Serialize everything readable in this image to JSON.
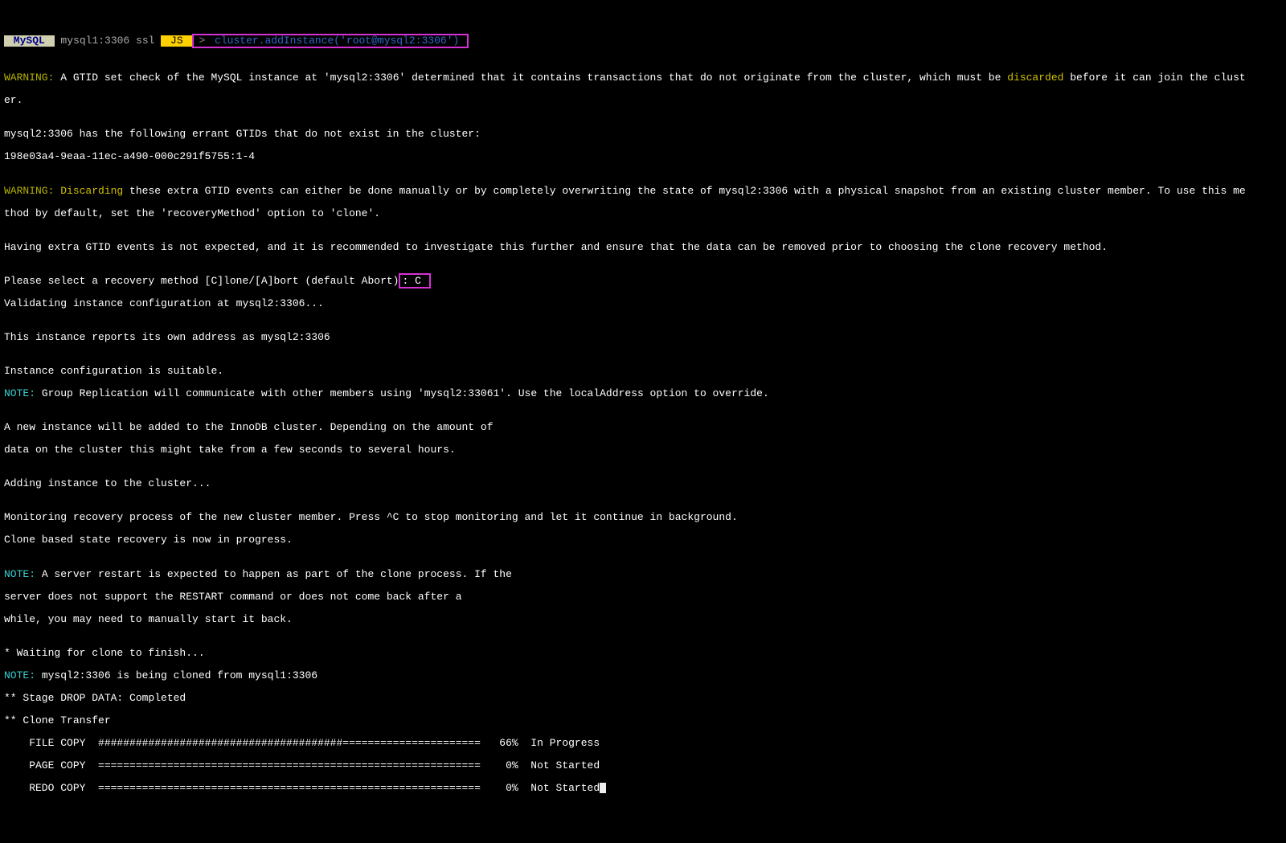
{
  "prompt": {
    "mysql_badge": " MySQL ",
    "connection": " mysql1:3306 ssl ",
    "lang_badge": " JS ",
    "arrow": ">",
    "command": " cluster.addInstance('root@mysql2:3306') "
  },
  "lines": {
    "w1_label": "WARNING:",
    "w1_a": " A GTID set check of the MySQL instance at 'mysql2:3306' determined that it contains transactions that do not originate from the cluster, which must be ",
    "w1_disc": "discarded",
    "w1_b": " before it can join the clust",
    "w1_c": "er.",
    "blank": "",
    "g1": "mysql2:3306 has the following errant GTIDs that do not exist in the cluster:",
    "g2": "198e03a4-9eaa-11ec-a490-000c291f5755:1-4",
    "w2_label": "WARNING:",
    "w2_disc": " Discarding",
    "w2_a": " these extra GTID events can either be done manually or by completely overwriting the state of mysql2:3306 with a physical snapshot from an existing cluster member. To use this me",
    "w2_b": "thod by default, set the 'recoveryMethod' option to 'clone'.",
    "h1": "Having extra GTID events is not expected, and it is recommended to investigate this further and ensure that the data can be removed prior to choosing the clone recovery method.",
    "p1_a": "Please select a recovery method [C]lone/[A]bort (default Abort)",
    "p1_b": ": C ",
    "v1": "Validating instance configuration at mysql2:3306...",
    "r1": "This instance reports its own address as mysql2:3306",
    "c1": "Instance configuration is suitable.",
    "n1_label": "NOTE:",
    "n1": " Group Replication will communicate with other members using 'mysql2:33061'. Use the localAddress option to override.",
    "a1": "A new instance will be added to the InnoDB cluster. Depending on the amount of",
    "a2": "data on the cluster this might take from a few seconds to several hours.",
    "add": "Adding instance to the cluster...",
    "m1": "Monitoring recovery process of the new cluster member. Press ^C to stop monitoring and let it continue in background.",
    "m2": "Clone based state recovery is now in progress.",
    "n2_label": "NOTE:",
    "n2a": " A server restart is expected to happen as part of the clone process. If the",
    "n2b": "server does not support the RESTART command or does not come back after a",
    "n2c": "while, you may need to manually start it back.",
    "wait": "* Waiting for clone to finish...",
    "n3_label": "NOTE:",
    "n3": " mysql2:3306 is being cloned from mysql1:3306",
    "s1": "** Stage DROP DATA: Completed",
    "s2": "** Clone Transfer",
    "fc": "    FILE COPY  #######################################======================   66%  In Progress",
    "pc": "    PAGE COPY  =============================================================    0%  Not Started",
    "rc": "    REDO COPY  =============================================================    0%  Not Started"
  }
}
